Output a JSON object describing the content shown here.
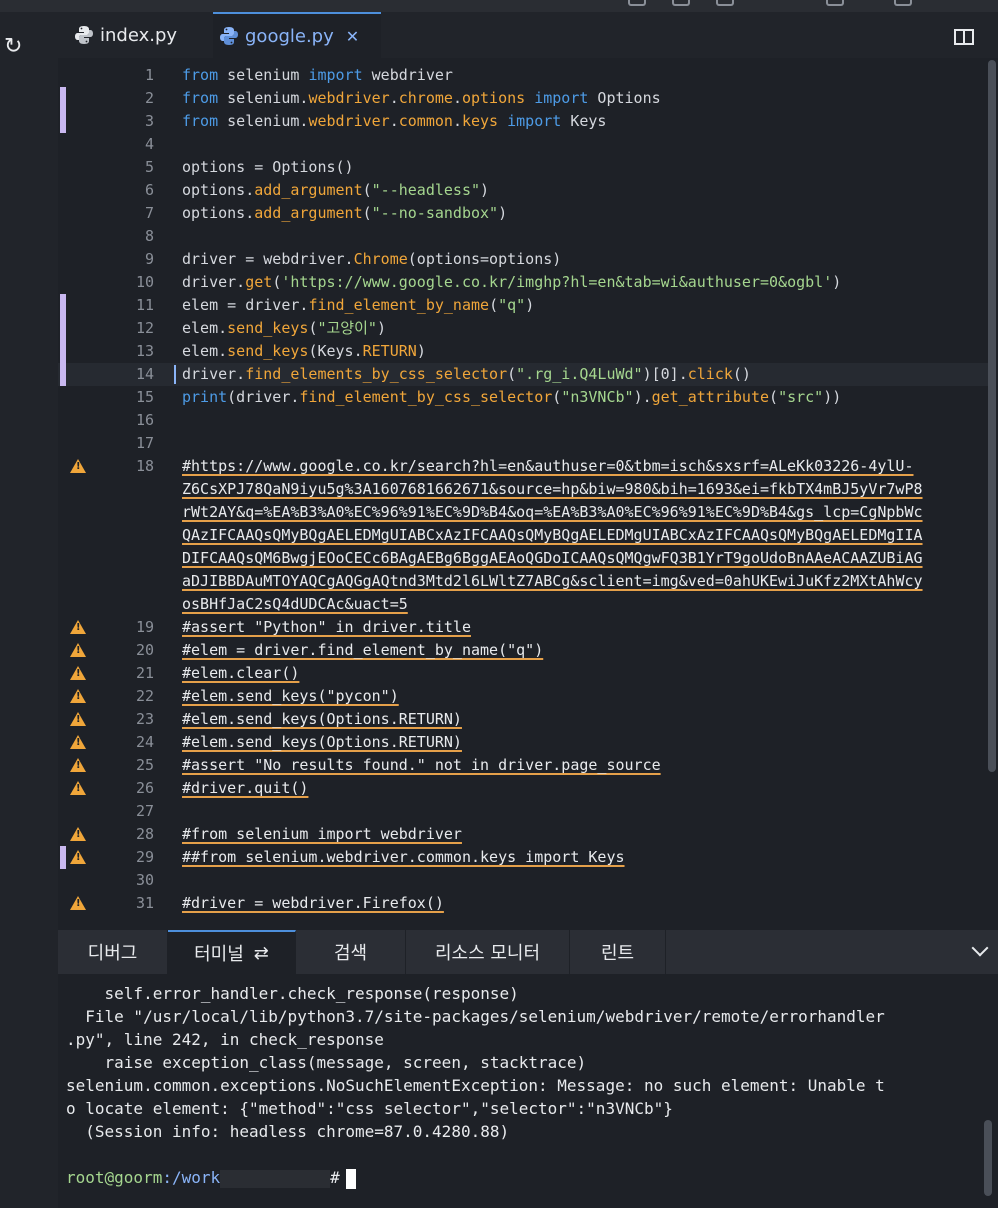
{
  "tabs": [
    {
      "label": "index.py",
      "active": false
    },
    {
      "label": "google.py",
      "active": true
    }
  ],
  "editor": {
    "lines": [
      {
        "n": "1",
        "code": "from selenium import webdriver",
        "kind": "code"
      },
      {
        "n": "2",
        "code": "from selenium.webdriver.chrome.options import Options",
        "kind": "code",
        "mark": true
      },
      {
        "n": "3",
        "code": "from selenium.webdriver.common.keys import Keys",
        "kind": "code",
        "mark": true
      },
      {
        "n": "4",
        "code": "",
        "kind": "code"
      },
      {
        "n": "5",
        "code": "options = Options()",
        "kind": "code"
      },
      {
        "n": "6",
        "code": "options.add_argument(\"--headless\")",
        "kind": "code"
      },
      {
        "n": "7",
        "code": "options.add_argument(\"--no-sandbox\")",
        "kind": "code"
      },
      {
        "n": "8",
        "code": "",
        "kind": "code"
      },
      {
        "n": "9",
        "code": "driver = webdriver.Chrome(options=options)",
        "kind": "code"
      },
      {
        "n": "10",
        "code": "driver.get('https://www.google.co.kr/imghp?hl=en&tab=wi&authuser=0&ogbl')",
        "kind": "code"
      },
      {
        "n": "11",
        "code": "elem = driver.find_element_by_name(\"q\")",
        "kind": "code",
        "mark": true
      },
      {
        "n": "12",
        "code": "elem.send_keys(\"고양이\")",
        "kind": "code",
        "mark": true
      },
      {
        "n": "13",
        "code": "elem.send_keys(Keys.RETURN)",
        "kind": "code",
        "mark": true
      },
      {
        "n": "14",
        "code": "driver.find_elements_by_css_selector(\".rg_i.Q4LuWd\")[0].click()",
        "kind": "code",
        "mark": true,
        "current": true
      },
      {
        "n": "15",
        "code": "print(driver.find_element_by_css_selector(\"n3VNCb\").get_attribute(\"src\"))",
        "kind": "code"
      },
      {
        "n": "16",
        "code": "",
        "kind": "code"
      },
      {
        "n": "17",
        "code": "",
        "kind": "code"
      },
      {
        "n": "18",
        "code": "#https://www.google.co.kr/search?hl=en&authuser=0&tbm=isch&sxsrf=ALeKk03226-4ylU-",
        "kind": "comment",
        "warn": true
      },
      {
        "n": "",
        "code": "Z6CsXPJ78QaN9iyu5g%3A1607681662671&source=hp&biw=980&bih=1693&ei=fkbTX4mBJ5yVr7wP8",
        "kind": "comment"
      },
      {
        "n": "",
        "code": "rWt2AY&q=%EA%B3%A0%EC%96%91%EC%9D%B4&oq=%EA%B3%A0%EC%96%91%EC%9D%B4&gs_lcp=CgNpbWc",
        "kind": "comment"
      },
      {
        "n": "",
        "code": "QAzIFCAAQsQMyBQgAELEDMgUIABCxAzIFCAAQsQMyBQgAELEDMgUIABCxAzIFCAAQsQMyBQgAELEDMgIIA",
        "kind": "comment"
      },
      {
        "n": "",
        "code": "DIFCAAQsQM6BwgjEOoCECc6BAgAEBg6BggAEAoQGDoICAAQsQMQgwFQ3B1YrT9goUdoBnAAeACAAZUBiAG",
        "kind": "comment"
      },
      {
        "n": "",
        "code": "aDJIBBDAuMTOYAQCgAQGgAQtnd3Mtd2l6LWltZ7ABCg&sclient=img&ved=0ahUKEwiJuKfz2MXtAhWcy",
        "kind": "comment"
      },
      {
        "n": "",
        "code": "osBHfJaC2sQ4dUDCAc&uact=5",
        "kind": "comment"
      },
      {
        "n": "19",
        "code": "#assert \"Python\" in driver.title",
        "kind": "comment",
        "warn": true
      },
      {
        "n": "20",
        "code": "#elem = driver.find_element_by_name(\"q\")",
        "kind": "comment",
        "warn": true
      },
      {
        "n": "21",
        "code": "#elem.clear()",
        "kind": "comment",
        "warn": true
      },
      {
        "n": "22",
        "code": "#elem.send_keys(\"pycon\")",
        "kind": "comment",
        "warn": true
      },
      {
        "n": "23",
        "code": "#elem.send_keys(Options.RETURN)",
        "kind": "comment",
        "warn": true
      },
      {
        "n": "24",
        "code": "#elem.send_keys(Options.RETURN)",
        "kind": "comment",
        "warn": true
      },
      {
        "n": "25",
        "code": "#assert \"No results found.\" not in driver.page_source",
        "kind": "comment",
        "warn": true
      },
      {
        "n": "26",
        "code": "#driver.quit()",
        "kind": "comment",
        "warn": true
      },
      {
        "n": "27",
        "code": "",
        "kind": "code"
      },
      {
        "n": "28",
        "code": "#from selenium import webdriver",
        "kind": "comment",
        "warn": true
      },
      {
        "n": "29",
        "code": "##from selenium.webdriver.common.keys import Keys",
        "kind": "comment",
        "warn": true,
        "mark": true
      },
      {
        "n": "30",
        "code": "",
        "kind": "code"
      },
      {
        "n": "31",
        "code": "#driver = webdriver.Firefox()",
        "kind": "comment",
        "warn": true
      }
    ]
  },
  "panel": {
    "tabs": [
      {
        "label": "디버그",
        "active": false
      },
      {
        "label": "터미널",
        "active": true,
        "icon": "refresh-icon"
      },
      {
        "label": "검색",
        "active": false
      },
      {
        "label": "리소스 모니터",
        "active": false
      },
      {
        "label": "린트",
        "active": false
      }
    ]
  },
  "terminal": {
    "lines": [
      "    self.error_handler.check_response(response)",
      "  File \"/usr/local/lib/python3.7/site-packages/selenium/webdriver/remote/errorhandler",
      ".py\", line 242, in check_response",
      "    raise exception_class(message, screen, stacktrace)",
      "selenium.common.exceptions.NoSuchElementException: Message: no such element: Unable t",
      "o locate element: {\"method\":\"css selector\",\"selector\":\"n3VNCb\"}",
      "  (Session info: headless chrome=87.0.4280.88)"
    ],
    "prompt_user": "root@goorm",
    "prompt_path": ":/work",
    "prompt_tail": "#"
  }
}
